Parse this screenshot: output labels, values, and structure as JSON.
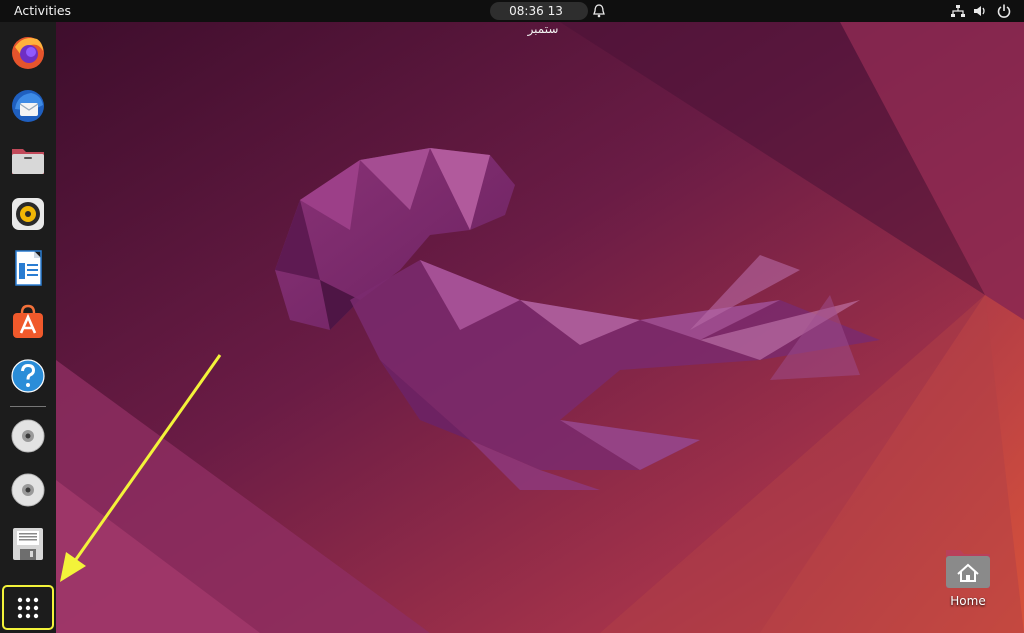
{
  "topbar": {
    "activities_label": "Activities",
    "clock_time": "08:36",
    "clock_date": "13 ستمبر"
  },
  "dock": {
    "items": [
      {
        "name": "firefox",
        "icon": "firefox-icon"
      },
      {
        "name": "thunderbird",
        "icon": "thunderbird-icon"
      },
      {
        "name": "files",
        "icon": "files-icon"
      },
      {
        "name": "rhythmbox",
        "icon": "rhythmbox-icon"
      },
      {
        "name": "libreoffice-writer",
        "icon": "writer-icon"
      },
      {
        "name": "ubuntu-software",
        "icon": "software-icon"
      },
      {
        "name": "help",
        "icon": "help-icon"
      },
      {
        "name": "disc-1",
        "icon": "disc-icon"
      },
      {
        "name": "disc-2",
        "icon": "disc-icon"
      },
      {
        "name": "floppy",
        "icon": "floppy-icon"
      }
    ],
    "show_apps_icon": "grid-icon"
  },
  "desktop": {
    "home_label": "Home"
  },
  "colors": {
    "topbar": "#0f0f0f",
    "dock": "#1c1c1c",
    "highlight": "#f3f33a",
    "wallpaper_dark": "#3a0c2a",
    "wallpaper_mid": "#7a2350",
    "wallpaper_warm": "#c4443e"
  }
}
